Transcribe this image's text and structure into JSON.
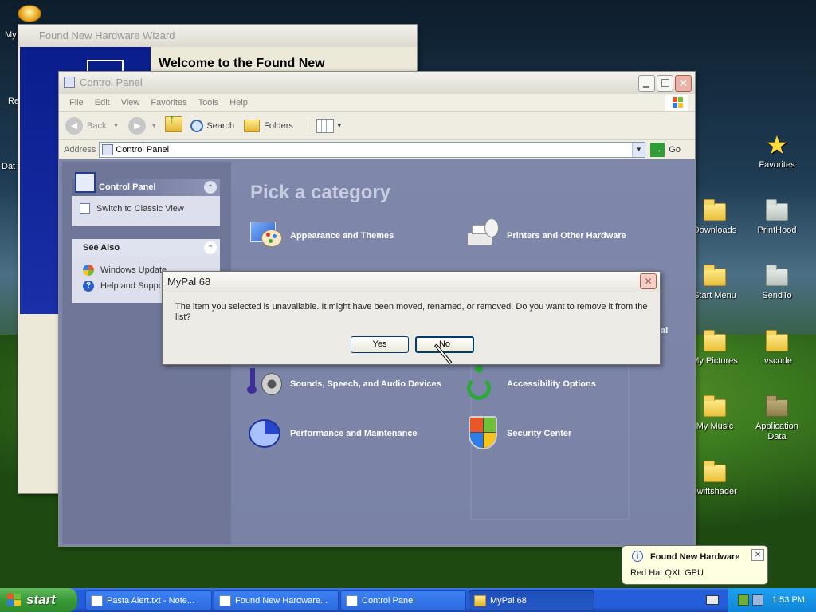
{
  "desktop": {
    "icons_left": [
      {
        "label": "My",
        "icon": "app-icon"
      },
      {
        "label": "Re",
        "icon": "recycle-icon"
      },
      {
        "label": "Dat",
        "icon": "folder-icon"
      }
    ],
    "icons_right": [
      {
        "label": "Favorites",
        "icon": "star-icon"
      },
      {
        "label": "Downloads",
        "icon": "folder-icon"
      },
      {
        "label": "PrintHood",
        "icon": "folder-icon"
      },
      {
        "label": "Start Menu",
        "icon": "folder-icon"
      },
      {
        "label": "SendTo",
        "icon": "folder-icon"
      },
      {
        "label": "My Pictures",
        "icon": "folder-icon"
      },
      {
        "label": ".vscode",
        "icon": "folder-icon"
      },
      {
        "label": "My Music",
        "icon": "folder-icon"
      },
      {
        "label": "Application\nData",
        "icon": "folder-icon"
      },
      {
        "label": "swiftshader",
        "icon": "folder-icon"
      }
    ]
  },
  "wizard": {
    "title": "Found New Hardware Wizard",
    "heading": "Welcome to the Found New"
  },
  "control_panel": {
    "title": "Control Panel",
    "menu": [
      "File",
      "Edit",
      "View",
      "Favorites",
      "Tools",
      "Help"
    ],
    "toolbar": {
      "back": "Back",
      "search": "Search",
      "folders": "Folders"
    },
    "address_label": "Address",
    "address_value": "Control Panel",
    "go": "Go",
    "sidebar": {
      "panel_title": "Control Panel",
      "switch_view": "Switch to Classic View",
      "see_also_title": "See Also",
      "see_also": [
        "Windows Update",
        "Help and Support"
      ]
    },
    "pick_title": "Pick a category",
    "categories": [
      {
        "label": "Appearance and Themes",
        "icon": "appearance-icon"
      },
      {
        "label": "Printers and Other Hardware",
        "icon": "printer-icon"
      },
      {
        "label": "Sounds, Speech, and Audio Devices",
        "icon": "sound-icon"
      },
      {
        "label": "Accessibility Options",
        "icon": "accessibility-icon"
      },
      {
        "label": "Performance and Maintenance",
        "icon": "performance-icon"
      },
      {
        "label": "Security Center",
        "icon": "shield-icon"
      }
    ],
    "partial_label": "al"
  },
  "dialog": {
    "title": "MyPal 68",
    "message": "The item you selected is unavailable.  It might have been moved, renamed, or removed.  Do you want to remove it from the list?",
    "yes": "Yes",
    "no": "No"
  },
  "balloon": {
    "title": "Found New Hardware",
    "body": "Red Hat QXL GPU"
  },
  "taskbar": {
    "start": "start",
    "buttons": [
      "Pasta Alert.txt - Note...",
      "Found New Hardware...",
      "Control Panel",
      "MyPal 68"
    ],
    "active_index": 3,
    "clock": "1:53 PM"
  }
}
